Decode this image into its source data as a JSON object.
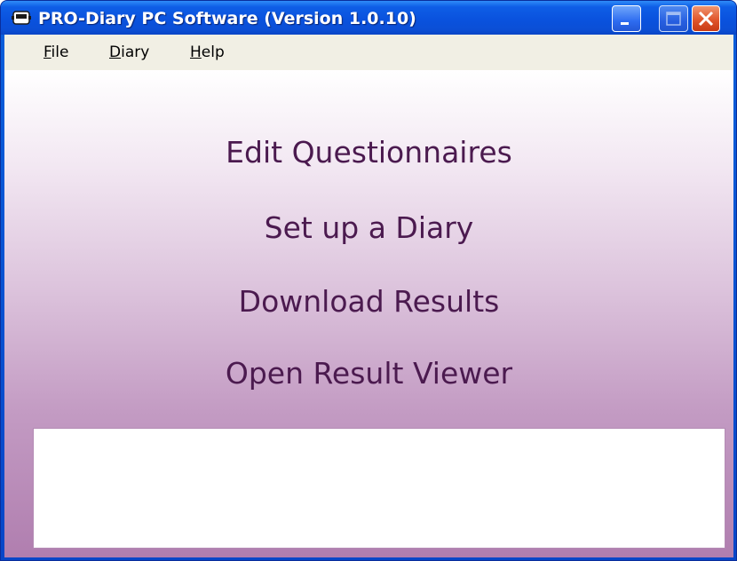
{
  "window": {
    "title": "PRO-Diary PC Software (Version 1.0.10)",
    "app_icon": "pro-diary-device-icon"
  },
  "controls": {
    "minimize_icon": "minimize-icon",
    "maximize_icon": "maximize-icon",
    "close_icon": "close-icon"
  },
  "menu": {
    "items": [
      {
        "accel": "F",
        "rest": "ile"
      },
      {
        "accel": "D",
        "rest": "iary"
      },
      {
        "accel": "H",
        "rest": "elp"
      }
    ]
  },
  "actions": {
    "edit_questionnaires": "Edit Questionnaires",
    "set_up_diary": "Set up a Diary",
    "download_results": "Download Results",
    "open_result_viewer": "Open Result Viewer"
  },
  "status_panel": {
    "text": ""
  },
  "colors": {
    "titlebar": "#0a52de",
    "menubar": "#f1efe4",
    "action_text": "#4b1a4f",
    "gradient_bottom": "#b07eaf"
  }
}
